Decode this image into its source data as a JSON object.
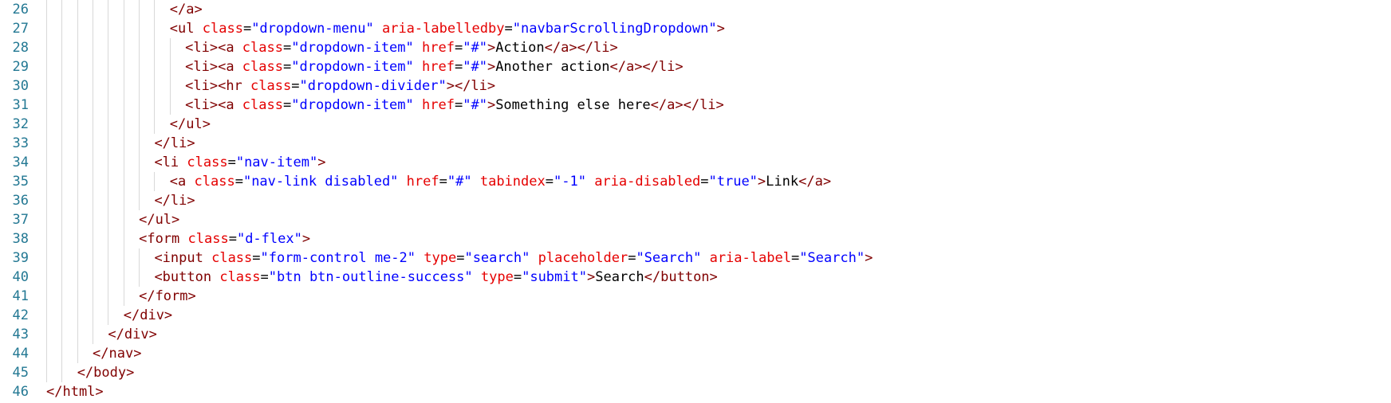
{
  "editor": {
    "lines": [
      {
        "num": "26",
        "indent": 8,
        "tokens": [
          {
            "type": "tag",
            "text": "</a>"
          }
        ]
      },
      {
        "num": "27",
        "indent": 8,
        "tokens": [
          {
            "type": "tag",
            "text": "<ul "
          },
          {
            "type": "attr",
            "text": "class"
          },
          {
            "type": "txt",
            "text": "="
          },
          {
            "type": "str",
            "text": "\"dropdown-menu\""
          },
          {
            "type": "txt",
            "text": " "
          },
          {
            "type": "attr",
            "text": "aria-labelledby"
          },
          {
            "type": "txt",
            "text": "="
          },
          {
            "type": "str",
            "text": "\"navbarScrollingDropdown\""
          },
          {
            "type": "tag",
            "text": ">"
          }
        ]
      },
      {
        "num": "28",
        "indent": 9,
        "tokens": [
          {
            "type": "tag",
            "text": "<li><a "
          },
          {
            "type": "attr",
            "text": "class"
          },
          {
            "type": "txt",
            "text": "="
          },
          {
            "type": "str",
            "text": "\"dropdown-item\""
          },
          {
            "type": "txt",
            "text": " "
          },
          {
            "type": "attr",
            "text": "href"
          },
          {
            "type": "txt",
            "text": "="
          },
          {
            "type": "str",
            "text": "\"#\""
          },
          {
            "type": "tag",
            "text": ">"
          },
          {
            "type": "txt",
            "text": "Action"
          },
          {
            "type": "tag",
            "text": "</a></li>"
          }
        ]
      },
      {
        "num": "29",
        "indent": 9,
        "tokens": [
          {
            "type": "tag",
            "text": "<li><a "
          },
          {
            "type": "attr",
            "text": "class"
          },
          {
            "type": "txt",
            "text": "="
          },
          {
            "type": "str",
            "text": "\"dropdown-item\""
          },
          {
            "type": "txt",
            "text": " "
          },
          {
            "type": "attr",
            "text": "href"
          },
          {
            "type": "txt",
            "text": "="
          },
          {
            "type": "str",
            "text": "\"#\""
          },
          {
            "type": "tag",
            "text": ">"
          },
          {
            "type": "txt",
            "text": "Another action"
          },
          {
            "type": "tag",
            "text": "</a></li>"
          }
        ]
      },
      {
        "num": "30",
        "indent": 9,
        "tokens": [
          {
            "type": "tag",
            "text": "<li><hr "
          },
          {
            "type": "attr",
            "text": "class"
          },
          {
            "type": "txt",
            "text": "="
          },
          {
            "type": "str",
            "text": "\"dropdown-divider\""
          },
          {
            "type": "tag",
            "text": "></li>"
          }
        ]
      },
      {
        "num": "31",
        "indent": 9,
        "tokens": [
          {
            "type": "tag",
            "text": "<li><a "
          },
          {
            "type": "attr",
            "text": "class"
          },
          {
            "type": "txt",
            "text": "="
          },
          {
            "type": "str",
            "text": "\"dropdown-item\""
          },
          {
            "type": "txt",
            "text": " "
          },
          {
            "type": "attr",
            "text": "href"
          },
          {
            "type": "txt",
            "text": "="
          },
          {
            "type": "str",
            "text": "\"#\""
          },
          {
            "type": "tag",
            "text": ">"
          },
          {
            "type": "txt",
            "text": "Something else here"
          },
          {
            "type": "tag",
            "text": "</a></li>"
          }
        ]
      },
      {
        "num": "32",
        "indent": 8,
        "tokens": [
          {
            "type": "tag",
            "text": "</ul>"
          }
        ]
      },
      {
        "num": "33",
        "indent": 7,
        "tokens": [
          {
            "type": "tag",
            "text": "</li>"
          }
        ]
      },
      {
        "num": "34",
        "indent": 7,
        "tokens": [
          {
            "type": "tag",
            "text": "<li "
          },
          {
            "type": "attr",
            "text": "class"
          },
          {
            "type": "txt",
            "text": "="
          },
          {
            "type": "str",
            "text": "\"nav-item\""
          },
          {
            "type": "tag",
            "text": ">"
          }
        ]
      },
      {
        "num": "35",
        "indent": 8,
        "tokens": [
          {
            "type": "tag",
            "text": "<a "
          },
          {
            "type": "attr",
            "text": "class"
          },
          {
            "type": "txt",
            "text": "="
          },
          {
            "type": "str",
            "text": "\"nav-link disabled\""
          },
          {
            "type": "txt",
            "text": " "
          },
          {
            "type": "attr",
            "text": "href"
          },
          {
            "type": "txt",
            "text": "="
          },
          {
            "type": "str",
            "text": "\"#\""
          },
          {
            "type": "txt",
            "text": " "
          },
          {
            "type": "attr",
            "text": "tabindex"
          },
          {
            "type": "txt",
            "text": "="
          },
          {
            "type": "str",
            "text": "\"-1\""
          },
          {
            "type": "txt",
            "text": " "
          },
          {
            "type": "attr",
            "text": "aria-disabled"
          },
          {
            "type": "txt",
            "text": "="
          },
          {
            "type": "str",
            "text": "\"true\""
          },
          {
            "type": "tag",
            "text": ">"
          },
          {
            "type": "txt",
            "text": "Link"
          },
          {
            "type": "tag",
            "text": "</a>"
          }
        ]
      },
      {
        "num": "36",
        "indent": 7,
        "tokens": [
          {
            "type": "tag",
            "text": "</li>"
          }
        ]
      },
      {
        "num": "37",
        "indent": 6,
        "tokens": [
          {
            "type": "tag",
            "text": "</ul>"
          }
        ]
      },
      {
        "num": "38",
        "indent": 6,
        "tokens": [
          {
            "type": "tag",
            "text": "<form "
          },
          {
            "type": "attr",
            "text": "class"
          },
          {
            "type": "txt",
            "text": "="
          },
          {
            "type": "str",
            "text": "\"d-flex\""
          },
          {
            "type": "tag",
            "text": ">"
          }
        ]
      },
      {
        "num": "39",
        "indent": 7,
        "tokens": [
          {
            "type": "tag",
            "text": "<input "
          },
          {
            "type": "attr",
            "text": "class"
          },
          {
            "type": "txt",
            "text": "="
          },
          {
            "type": "str",
            "text": "\"form-control me-2\""
          },
          {
            "type": "txt",
            "text": " "
          },
          {
            "type": "attr",
            "text": "type"
          },
          {
            "type": "txt",
            "text": "="
          },
          {
            "type": "str",
            "text": "\"search\""
          },
          {
            "type": "txt",
            "text": " "
          },
          {
            "type": "attr",
            "text": "placeholder"
          },
          {
            "type": "txt",
            "text": "="
          },
          {
            "type": "str",
            "text": "\"Search\""
          },
          {
            "type": "txt",
            "text": " "
          },
          {
            "type": "attr",
            "text": "aria-label"
          },
          {
            "type": "txt",
            "text": "="
          },
          {
            "type": "str",
            "text": "\"Search\""
          },
          {
            "type": "tag",
            "text": ">"
          }
        ]
      },
      {
        "num": "40",
        "indent": 7,
        "tokens": [
          {
            "type": "tag",
            "text": "<button "
          },
          {
            "type": "attr",
            "text": "class"
          },
          {
            "type": "txt",
            "text": "="
          },
          {
            "type": "str",
            "text": "\"btn btn-outline-success\""
          },
          {
            "type": "txt",
            "text": " "
          },
          {
            "type": "attr",
            "text": "type"
          },
          {
            "type": "txt",
            "text": "="
          },
          {
            "type": "str",
            "text": "\"submit\""
          },
          {
            "type": "tag",
            "text": ">"
          },
          {
            "type": "txt",
            "text": "Search"
          },
          {
            "type": "tag",
            "text": "</button>"
          }
        ]
      },
      {
        "num": "41",
        "indent": 6,
        "tokens": [
          {
            "type": "tag",
            "text": "</form>"
          }
        ]
      },
      {
        "num": "42",
        "indent": 5,
        "tokens": [
          {
            "type": "tag",
            "text": "</div>"
          }
        ]
      },
      {
        "num": "43",
        "indent": 4,
        "tokens": [
          {
            "type": "tag",
            "text": "</div>"
          }
        ]
      },
      {
        "num": "44",
        "indent": 3,
        "tokens": [
          {
            "type": "tag",
            "text": "</nav>"
          }
        ]
      },
      {
        "num": "45",
        "indent": 2,
        "tokens": [
          {
            "type": "tag",
            "text": "</body>"
          }
        ]
      },
      {
        "num": "46",
        "indent": 0,
        "tokens": [
          {
            "type": "tag",
            "text": "</html>"
          }
        ]
      }
    ]
  },
  "colors": {
    "line_number": "#237893",
    "tag": "#800000",
    "attribute": "#e50000",
    "string": "#0000ff",
    "text": "#000000",
    "indent_guide": "#d8d8d8",
    "background": "#ffffff"
  }
}
